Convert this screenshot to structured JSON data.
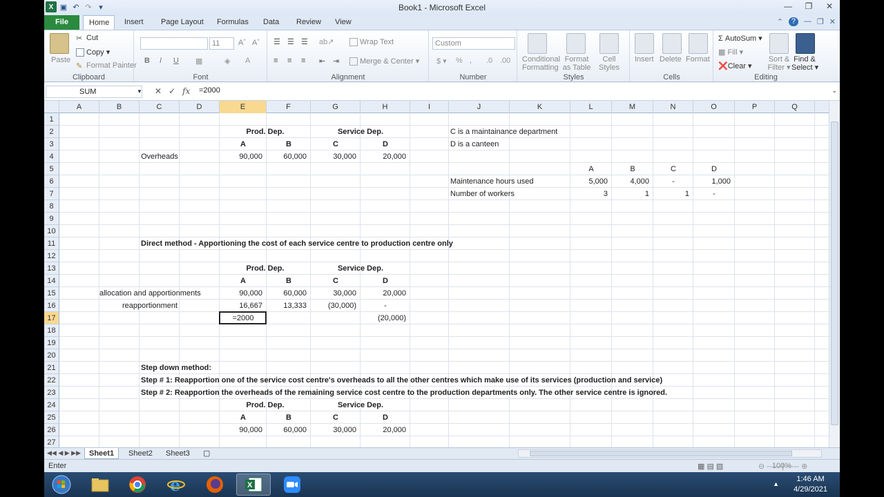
{
  "window": {
    "title": "Book1  -  Microsoft Excel"
  },
  "ribbon_tabs": [
    "File",
    "Home",
    "Insert",
    "Page Layout",
    "Formulas",
    "Data",
    "Review",
    "View"
  ],
  "ribbon": {
    "clipboard": {
      "paste": "Paste",
      "cut": "Cut",
      "copy": "Copy",
      "format_painter": "Format Painter",
      "label": "Clipboard"
    },
    "font": {
      "size": "11",
      "label": "Font"
    },
    "alignment": {
      "wrap_text": "Wrap Text",
      "merge_center": "Merge & Center",
      "label": "Alignment"
    },
    "number": {
      "format": "Custom",
      "label": "Number"
    },
    "styles": {
      "conditional": "Conditional",
      "conditional2": "Formatting",
      "format_as": "Format",
      "format_as2": "as Table",
      "cell": "Cell",
      "cell2": "Styles",
      "label": "Styles"
    },
    "cells": {
      "insert": "Insert",
      "delete": "Delete",
      "format": "Format",
      "label": "Cells"
    },
    "editing": {
      "autosum": "AutoSum",
      "fill": "Fill",
      "clear": "Clear",
      "sort": "Sort &",
      "sort2": "Filter",
      "find": "Find &",
      "find2": "Select",
      "label": "Editing"
    }
  },
  "formula_bar": {
    "name_box": "SUM",
    "formula": "=2000"
  },
  "columns": [
    "A",
    "B",
    "C",
    "D",
    "E",
    "F",
    "G",
    "H",
    "I",
    "J",
    "K",
    "L",
    "M",
    "N",
    "O",
    "P",
    "Q",
    "R"
  ],
  "rows": [
    "1",
    "2",
    "3",
    "4",
    "5",
    "6",
    "7",
    "8",
    "9",
    "10",
    "11",
    "12",
    "13",
    "14",
    "15",
    "16",
    "17",
    "18",
    "19",
    "20",
    "21",
    "22",
    "23",
    "24",
    "25",
    "26",
    "27"
  ],
  "cells": {
    "E2": "Prod. Dep.",
    "G2": "Service Dep.",
    "E3": "A",
    "F3": "B",
    "G3": "C",
    "H3": "D",
    "C4": "Overheads",
    "E4": "90,000",
    "F4": "60,000",
    "G4": "30,000",
    "H4": "20,000",
    "J2": "C is a maintainance department",
    "J3": "D is a canteen",
    "L5": "A",
    "M5": "B",
    "N5": "C",
    "O5": "D",
    "J6": "Maintenance hours used",
    "L6": "5,000",
    "M6": "4,000",
    "N6": "-",
    "O6": "1,000",
    "J7": "Number of workers",
    "L7": "3",
    "M7": "1",
    "N7": "1",
    "O7": "-",
    "C11": "Direct method - Apportioning the cost of each service centre to production centre only",
    "E13": "Prod. Dep.",
    "G13": "Service Dep.",
    "E14": "A",
    "F14": "B",
    "G14": "C",
    "H14": "D",
    "C15": "allocation and apportionments",
    "E15": "90,000",
    "F15": "60,000",
    "G15": "30,000",
    "H15": "20,000",
    "C16": "reapportionment",
    "E16": "16,667",
    "F16": "13,333",
    "G16": "(30,000)",
    "H16": "-",
    "E17": "=2000",
    "H17": "(20,000)",
    "C21": "Step down method:",
    "C22": "Step # 1: Reapportion one of the service cost centre's overheads to all the other centres which make use of its services (production and service)",
    "C23": "Step # 2: Reapportion the overheads of the remaining service cost centre to the production departments only. The other service centre is ignored.",
    "E24": "Prod. Dep.",
    "G24": "Service Dep.",
    "E25": "A",
    "F25": "B",
    "G25": "C",
    "H25": "D",
    "E26": "90,000",
    "F26": "60,000",
    "G26": "30,000",
    "H26": "20,000"
  },
  "sheets": [
    "Sheet1",
    "Sheet2",
    "Sheet3"
  ],
  "status": {
    "mode": "Enter",
    "zoom": "100%"
  },
  "taskbar": {
    "time": "1:46 AM",
    "date": "4/29/2021"
  }
}
